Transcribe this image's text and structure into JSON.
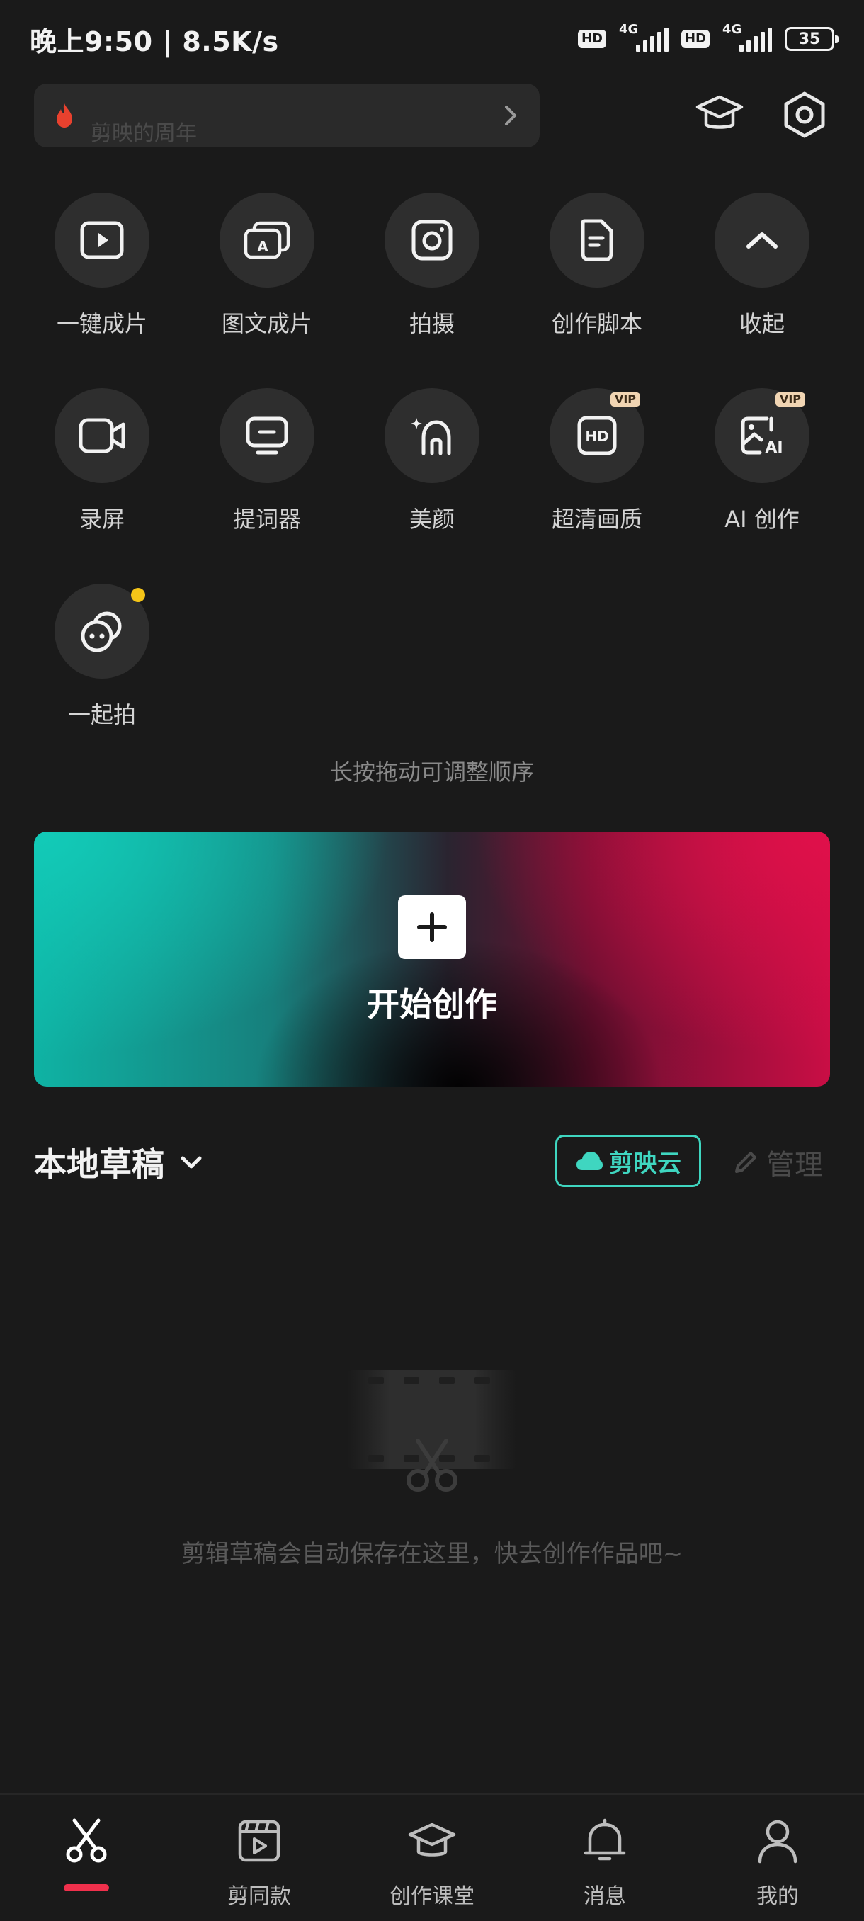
{
  "status_bar": {
    "time_speed": "晚上9:50 | 8.5K/s",
    "hd": "HD",
    "network": "4G",
    "battery": "35"
  },
  "search": {
    "hint": "剪映的周年"
  },
  "tools": [
    {
      "label": "一键成片",
      "icon": "play-icon"
    },
    {
      "label": "图文成片",
      "icon": "text-to-video-icon"
    },
    {
      "label": "拍摄",
      "icon": "camera-icon"
    },
    {
      "label": "创作脚本",
      "icon": "script-icon"
    },
    {
      "label": "收起",
      "icon": "chevron-up-icon"
    },
    {
      "label": "录屏",
      "icon": "screen-record-icon"
    },
    {
      "label": "提词器",
      "icon": "teleprompter-icon"
    },
    {
      "label": "美颜",
      "icon": "beauty-icon"
    },
    {
      "label": "超清画质",
      "icon": "hd-icon",
      "badge": "VIP"
    },
    {
      "label": "AI 创作",
      "icon": "ai-create-icon",
      "badge": "VIP"
    },
    {
      "label": "一起拍",
      "icon": "shoot-together-icon"
    }
  ],
  "reorder_hint": "长按拖动可调整顺序",
  "banner": {
    "label": "开始创作"
  },
  "drafts": {
    "title": "本地草稿",
    "cloud_label": "剪映云",
    "manage_label": "管理",
    "empty_text": "剪辑草稿会自动保存在这里，快去创作作品吧~"
  },
  "bottom_nav": [
    {
      "label": "",
      "icon": "scissors-icon",
      "active": true
    },
    {
      "label": "剪同款",
      "icon": "template-icon"
    },
    {
      "label": "创作课堂",
      "icon": "graduation-cap-icon"
    },
    {
      "label": "消息",
      "icon": "bell-icon"
    },
    {
      "label": "我的",
      "icon": "person-icon"
    }
  ],
  "colors": {
    "background": "#1a1a1a",
    "accent_teal": "#3fd6c0",
    "accent_red": "#f0304c",
    "vip_badge": "#f1d5b3"
  }
}
